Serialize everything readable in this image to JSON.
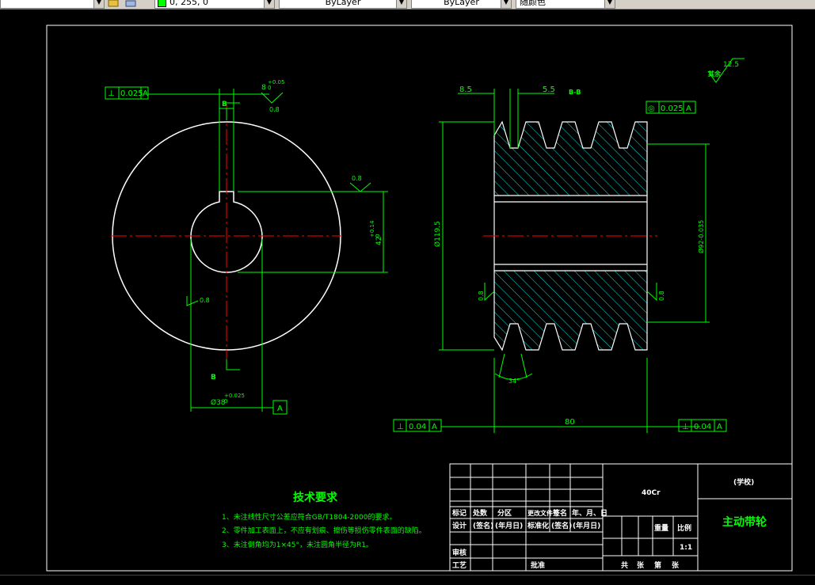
{
  "toolbar": {
    "color_combo": "0, 255, 0",
    "linetype_combo": "ByLayer",
    "lineweight_combo": "ByLayer",
    "plotstyle_combo": "随颜色"
  },
  "drawing": {
    "frame_colors": {
      "border": "#ffffff",
      "lines": "#00ff00",
      "center": "#ff0000",
      "hatch": "#00ffff",
      "text": "#00ff00",
      "title_text": "#ffffff"
    },
    "left_view": {
      "flatness_box": {
        "symbol": "⊥",
        "value": "0.025",
        "datum": "A"
      },
      "key_width": "8",
      "key_width_tol": "+0.05",
      "key_width_tol_lower": "0",
      "rough_top": "0.8",
      "section_B_top": "B",
      "section_B_bottom": "B",
      "rough_right": "0.8",
      "dim_depth": "42",
      "dim_depth_tol_upper": "+0.14",
      "dim_depth_tol_lower": "0",
      "rough_left": "0.8",
      "bore_dim": "Ø38",
      "bore_tol_upper": "+0.025",
      "bore_tol_lower": "0",
      "datum_A": "A"
    },
    "right_view": {
      "dim_left": "8.5",
      "dim_right": "5.5",
      "section_label": "B-B",
      "runout_box": {
        "symbol": "◎",
        "value": "0.025",
        "datum": "A"
      },
      "rough_corner_label": "其余",
      "rough_corner_value": "12.5",
      "dia_outer": "Ø119.5",
      "dia_pitch": "Ø92-0.035",
      "rough_left": "0.8",
      "rough_right": "0.8",
      "angle": "34°",
      "width_dim": "80",
      "perp_left": {
        "symbol": "⊥",
        "value": "0.04",
        "datum": "A"
      },
      "perp_right": {
        "symbol": "⊥",
        "value": "0.04",
        "datum": "A"
      }
    },
    "tech_req": {
      "title": "技术要求",
      "items": [
        "1、未注线性尺寸公差应符合GB/T1804-2000的要求。",
        "2、零件加工表面上，不应有划痕、擦伤等损伤零件表面的缺陷。",
        "3、未注倒角均为1×45°，未注圆角半径为R1。"
      ]
    },
    "title_block": {
      "material": "40Cr",
      "school": "(学校)",
      "part_name": "主动带轮",
      "header_row": [
        "标记",
        "处数",
        "分区",
        "更改文件号",
        "签名",
        "年、月、日"
      ],
      "design_row": [
        "设计",
        "(签名)",
        "(年月日)",
        "标准化",
        "(签名)",
        "(年月日)"
      ],
      "review": "审核",
      "process": "工艺",
      "approve": "批准",
      "weight": "重量",
      "scale_label": "比例",
      "scale_value": "1:1",
      "sheets": [
        "共",
        "张",
        "第",
        "张"
      ]
    }
  }
}
